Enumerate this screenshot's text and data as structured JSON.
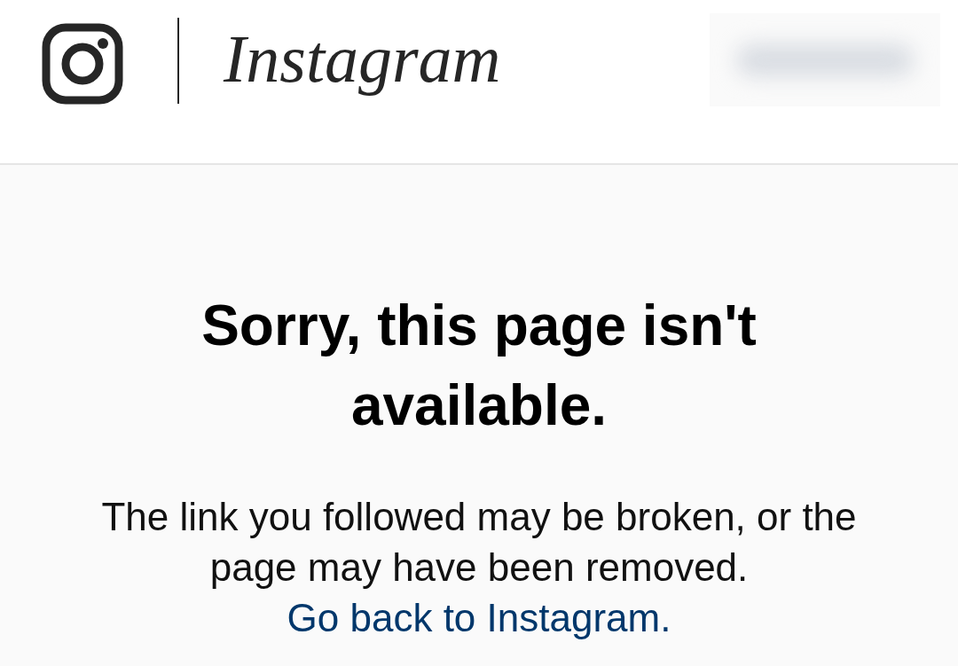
{
  "header": {
    "wordmark": "Instagram"
  },
  "error": {
    "title": "Sorry, this page isn't available.",
    "message": "The link you followed may be broken, or the page may have been removed.",
    "link": "Go back to Instagram."
  }
}
